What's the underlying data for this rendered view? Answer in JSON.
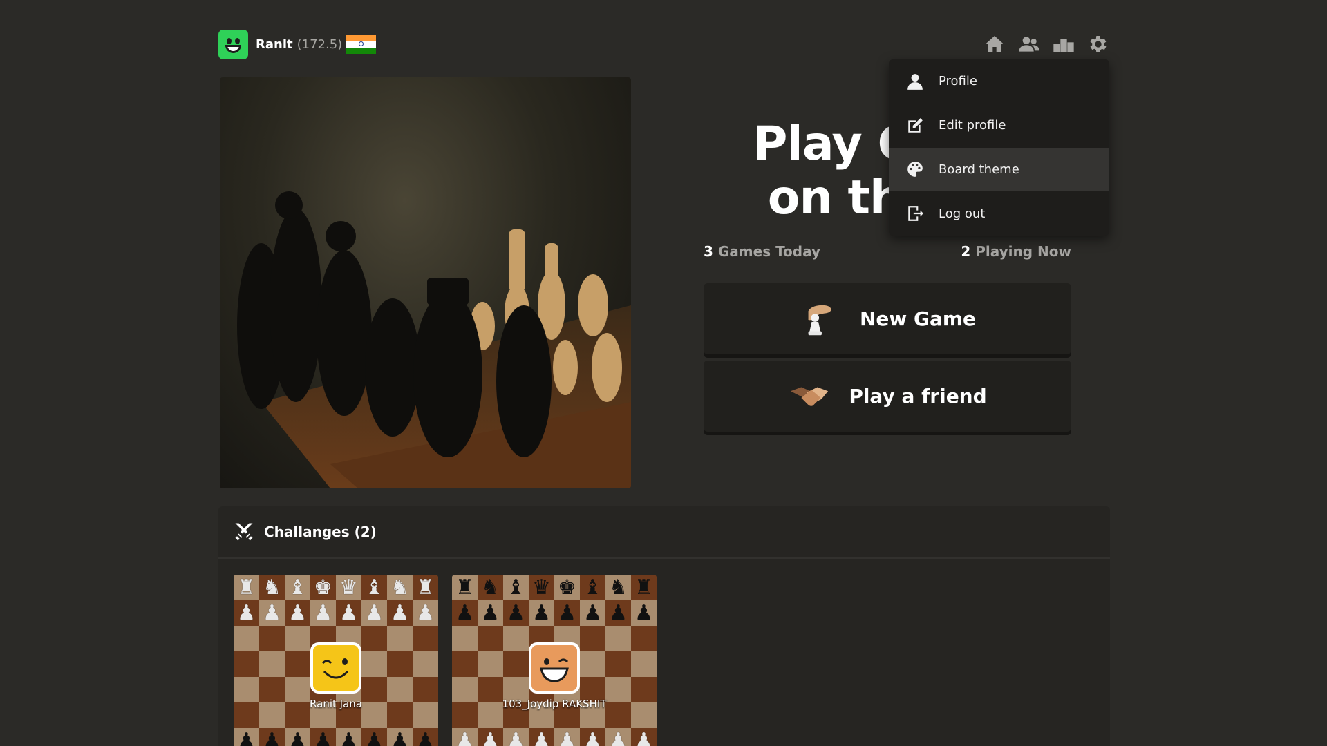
{
  "header": {
    "username": "Ranit",
    "rating": "(172.5)",
    "flag_colors": [
      "#ff9933",
      "#ffffff",
      "#138808"
    ],
    "avatar_color": "#2fd158",
    "nav_icons": [
      "home-icon",
      "friends-icon",
      "leaderboard-icon",
      "gear-icon"
    ]
  },
  "hero": {
    "headline_line1": "Play Ches",
    "headline_line2": "on the #"
  },
  "stats": {
    "games_today_count": "3",
    "games_today_label": "Games Today",
    "playing_now_count": "2",
    "playing_now_label": "Playing Now"
  },
  "buttons": {
    "new_game": "New Game",
    "play_friend": "Play a friend"
  },
  "menu": {
    "items": [
      {
        "label": "Profile",
        "icon": "user-icon"
      },
      {
        "label": "Edit profile",
        "icon": "edit-icon"
      },
      {
        "label": "Board theme",
        "icon": "palette-icon",
        "active": true
      },
      {
        "label": "Log out",
        "icon": "logout-icon"
      }
    ]
  },
  "challenges": {
    "title": "Challanges (2)",
    "boards": [
      {
        "player": "Ranit Jana",
        "avatar_color": "#f5c518",
        "orientation": "white-top"
      },
      {
        "player": "103_Joydip RAKSHIT",
        "avatar_color": "#e89a5c",
        "orientation": "black-top"
      }
    ]
  },
  "colors": {
    "background": "#2b2a27",
    "board_light": "#a98d6f",
    "board_dark": "#6e3a1c",
    "menu_bg": "#1e1d1b",
    "menu_active": "#353432"
  }
}
